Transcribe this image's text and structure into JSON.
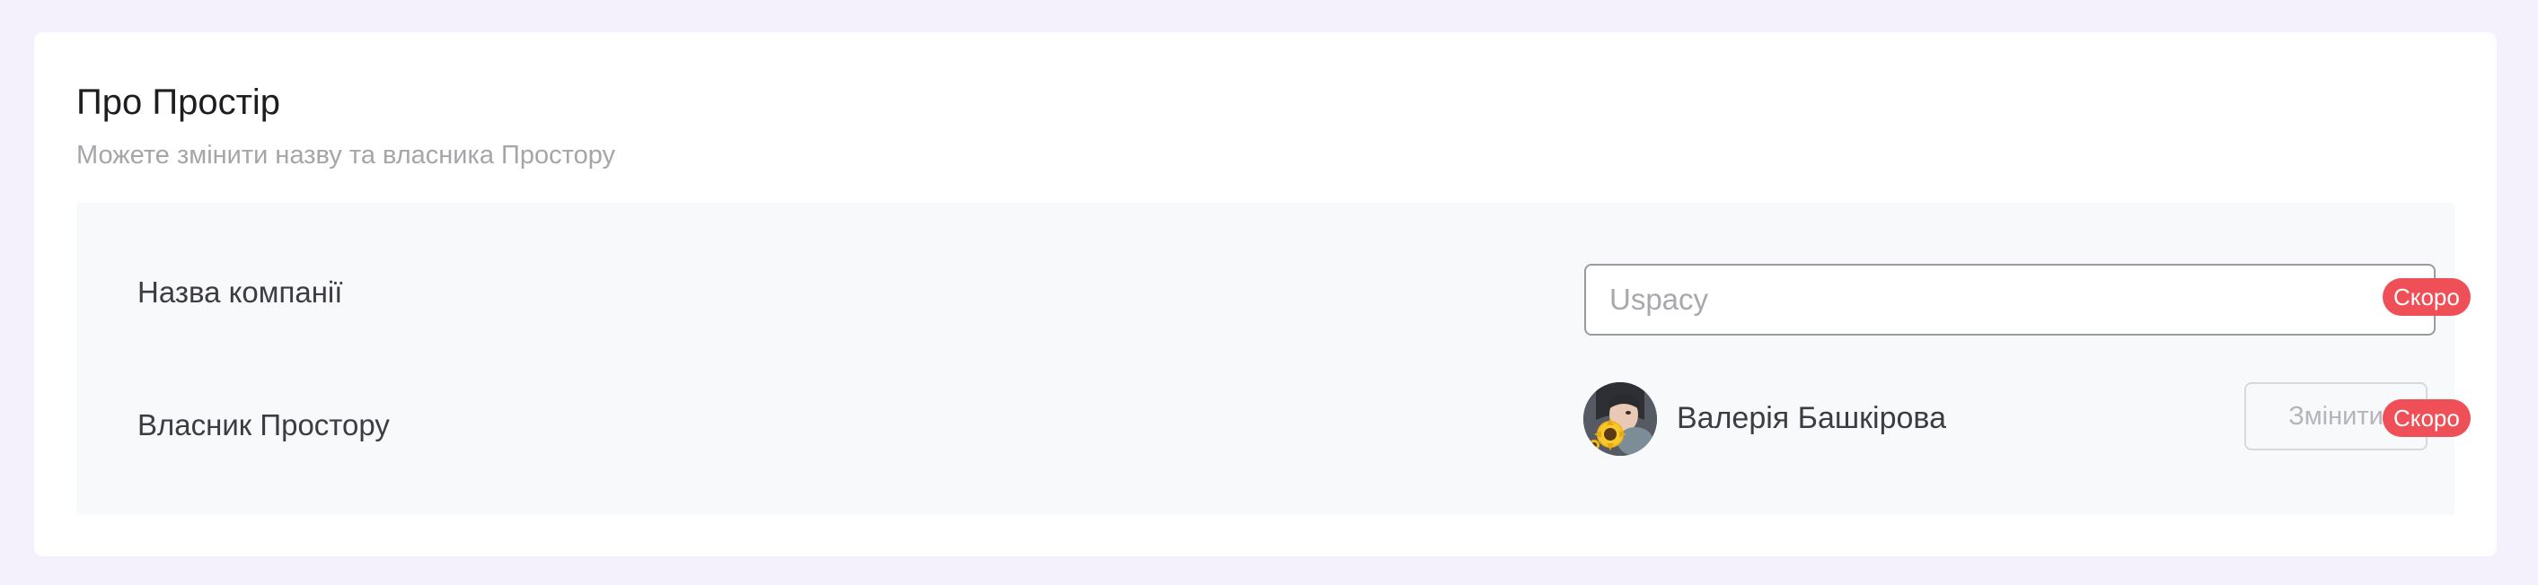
{
  "section": {
    "title": "Про Простір",
    "subtitle": "Можете змінити назву та власника Простору"
  },
  "company": {
    "label": "Назва компанії",
    "input_value": "",
    "input_placeholder": "Uspacy",
    "badge": "Скоро"
  },
  "owner": {
    "label": "Власник Простору",
    "avatar_icon": "user-avatar-photo",
    "name": "Валерія Башкірова",
    "change_label": "Змінити",
    "badge": "Скоро"
  },
  "colors": {
    "background": "#f4f1fd",
    "card": "#ffffff",
    "panel": "#f8f9fb",
    "badge": "#ef4f57",
    "text_primary": "#1e1e22",
    "text_muted": "#a5a5aa"
  }
}
